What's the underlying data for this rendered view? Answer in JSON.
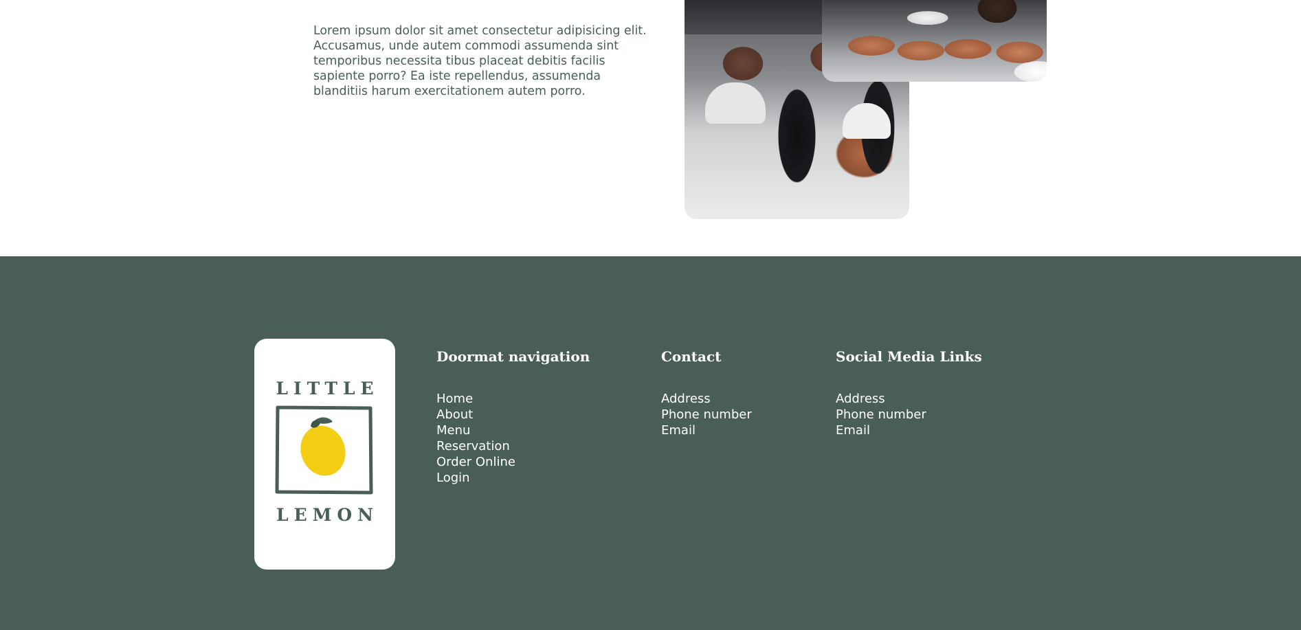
{
  "about": {
    "body_text": "Lorem ipsum dolor sit amet consectetur adipisicing elit. Accusamus, unde autem commodi assumenda sint temporibus necessita tibus placeat debitis facilis sapiente porro? Ea iste repellendus, assumenda blanditiis harum exercitationem autem porro."
  },
  "logo": {
    "line1": "LITTLE",
    "line2": "LEMON"
  },
  "footer": {
    "doormat": {
      "heading": "Doormat navigation",
      "links": [
        "Home",
        "About",
        "Menu",
        "Reservation",
        "Order Online",
        "Login"
      ]
    },
    "contact": {
      "heading": "Contact",
      "items": [
        "Address",
        "Phone number",
        "Email"
      ]
    },
    "social": {
      "heading": "Social Media Links",
      "items": [
        "Address",
        "Phone number",
        "Email"
      ]
    }
  },
  "colors": {
    "footer_bg": "#495e57",
    "lemon_yellow": "#f4ce14",
    "white": "#ffffff"
  }
}
